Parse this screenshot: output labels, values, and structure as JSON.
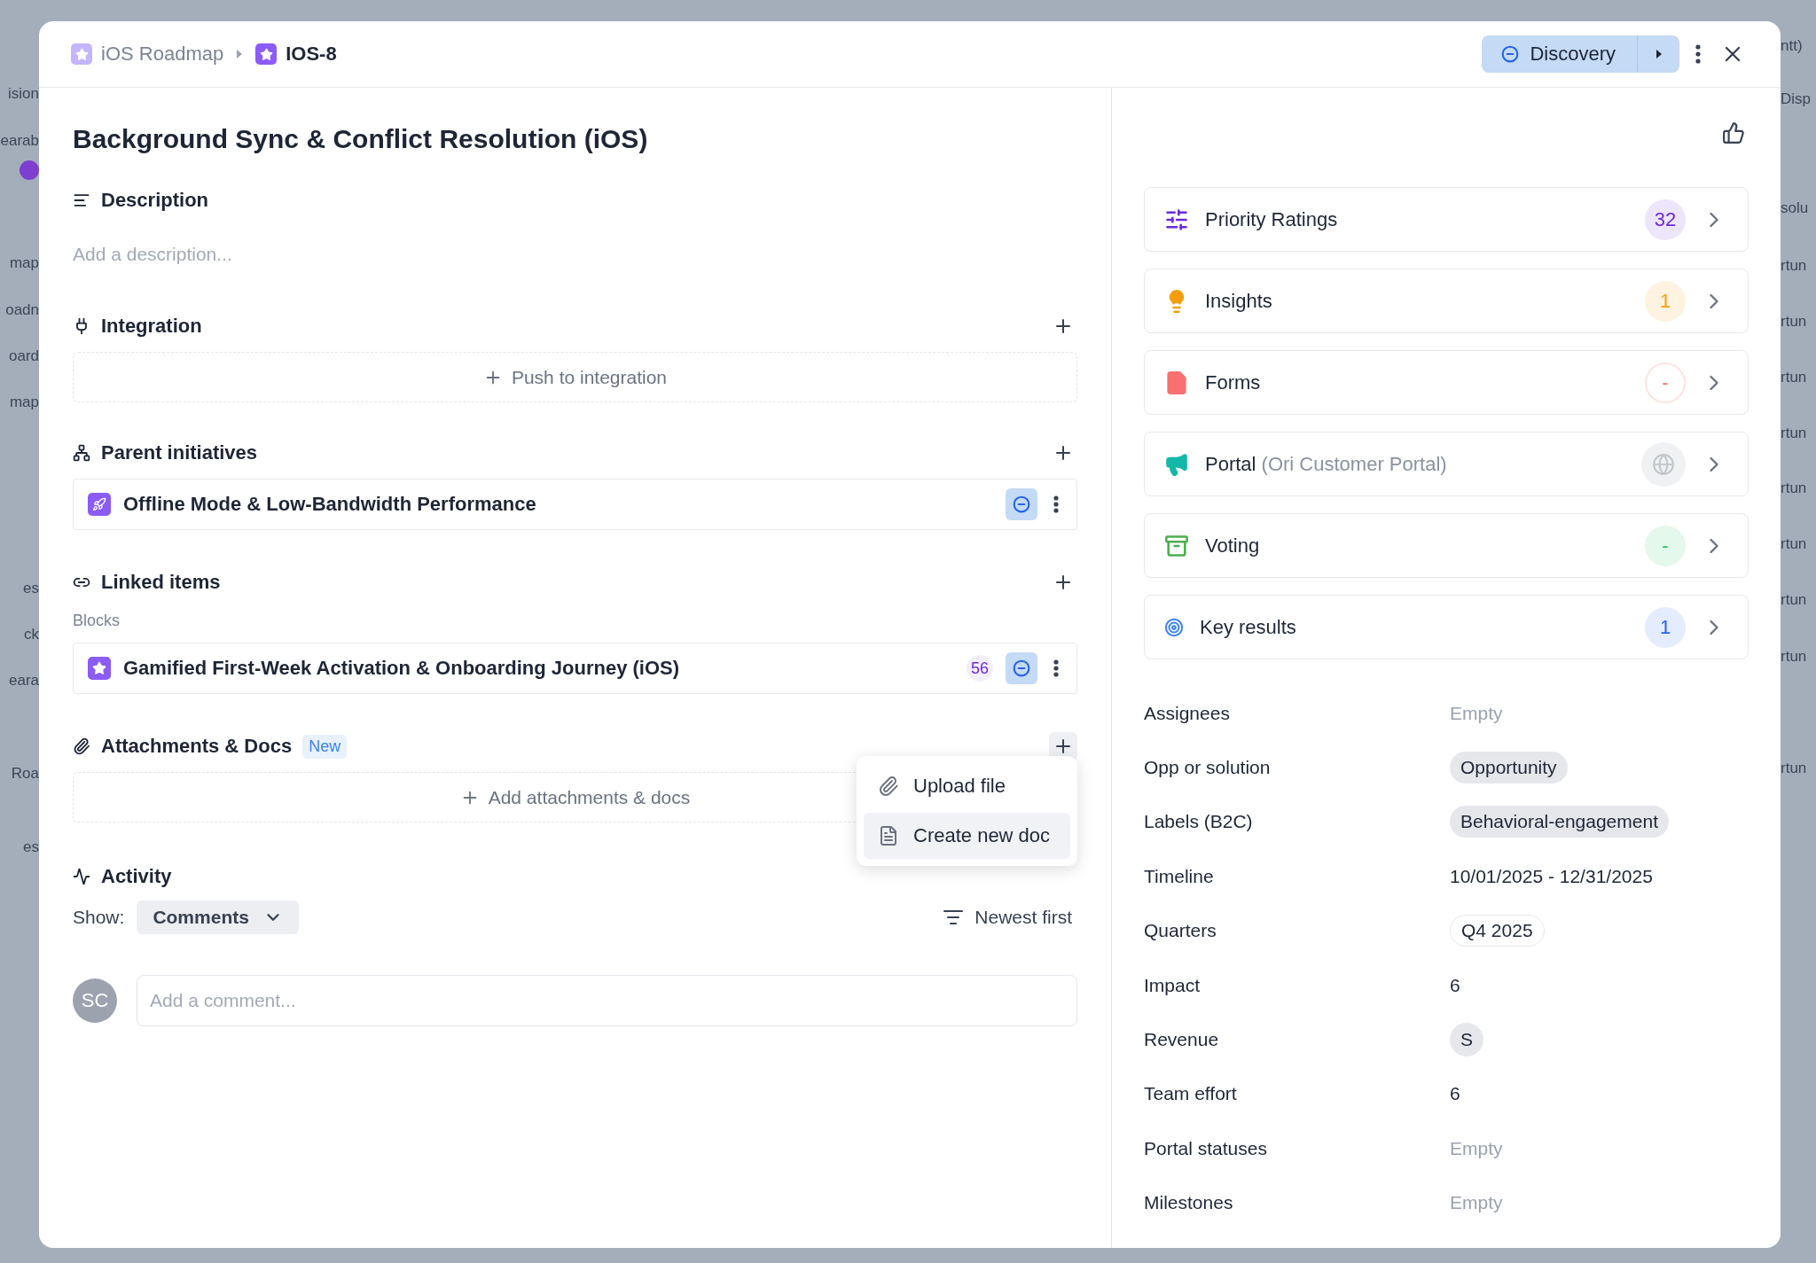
{
  "backdrop": {
    "left_fragments": [
      "ision",
      "earab",
      "map",
      "oadn",
      "oard",
      "map",
      "es",
      "ck",
      "eara",
      "Roa",
      "es"
    ],
    "right_fragments": [
      "ntt)",
      "Disp",
      "solu",
      "rtun",
      "rtun",
      "rtun",
      "rtun",
      "rtun",
      "rtun",
      "rtun",
      "rtun",
      "rtun"
    ]
  },
  "header": {
    "breadcrumbs": [
      {
        "label": "iOS Roadmap",
        "current": false
      },
      {
        "label": "IOS-8",
        "current": true
      }
    ],
    "status": "Discovery"
  },
  "title": "Background Sync & Conflict Resolution (iOS)",
  "description": {
    "heading": "Description",
    "placeholder": "Add a description..."
  },
  "integration": {
    "heading": "Integration",
    "action": "Push to integration"
  },
  "parent_initiatives": {
    "heading": "Parent initiatives",
    "items": [
      {
        "kind": "initiative",
        "title": "Offline Mode & Low-Bandwidth Performance"
      }
    ]
  },
  "linked_items": {
    "heading": "Linked items",
    "group": "Blocks",
    "items": [
      {
        "kind": "feature",
        "title": "Gamified First-Week Activation & Onboarding Journey (iOS)",
        "score": "56"
      }
    ]
  },
  "attachments": {
    "heading": "Attachments & Docs",
    "badge": "New",
    "action": "Add attachments & docs",
    "menu": [
      {
        "kind": "upload",
        "label": "Upload file",
        "selected": false
      },
      {
        "kind": "doc",
        "label": "Create new doc",
        "selected": true
      }
    ]
  },
  "activity": {
    "heading": "Activity",
    "show_label": "Show:",
    "filter": "Comments",
    "sort": "Newest first",
    "avatar": "SC",
    "comment_placeholder": "Add a comment..."
  },
  "cards": [
    {
      "kind": "ratings",
      "label": "Priority Ratings",
      "count": "32",
      "color": "#6d28d9"
    },
    {
      "kind": "insights",
      "label": "Insights",
      "count": "1",
      "color": "#f59e0b"
    },
    {
      "kind": "forms",
      "label": "Forms",
      "count": "-",
      "color": "#f87171"
    },
    {
      "kind": "portal",
      "label": "Portal",
      "note": "(Ori Customer Portal)",
      "color": "#c4c8ce"
    },
    {
      "kind": "voting",
      "label": "Voting",
      "count": "-",
      "color": "#22c55e"
    },
    {
      "kind": "key_results",
      "label": "Key results",
      "count": "1",
      "color": "#2563eb"
    }
  ],
  "properties": [
    {
      "label": "Assignees",
      "value": "Empty",
      "kind": "empty"
    },
    {
      "label": "Opp or solution",
      "value": "Opportunity",
      "kind": "tag"
    },
    {
      "label": "Labels (B2C)",
      "value": "Behavioral-engagement",
      "kind": "tag"
    },
    {
      "label": "Timeline",
      "value": "10/01/2025 - 12/31/2025",
      "kind": "text"
    },
    {
      "label": "Quarters",
      "value": "Q4 2025",
      "kind": "outline_tag"
    },
    {
      "label": "Impact",
      "value": "6",
      "kind": "text"
    },
    {
      "label": "Revenue",
      "value": "S",
      "kind": "avatar"
    },
    {
      "label": "Team effort",
      "value": "6",
      "kind": "text"
    },
    {
      "label": "Portal statuses",
      "value": "Empty",
      "kind": "empty"
    },
    {
      "label": "Milestones",
      "value": "Empty",
      "kind": "empty"
    }
  ]
}
